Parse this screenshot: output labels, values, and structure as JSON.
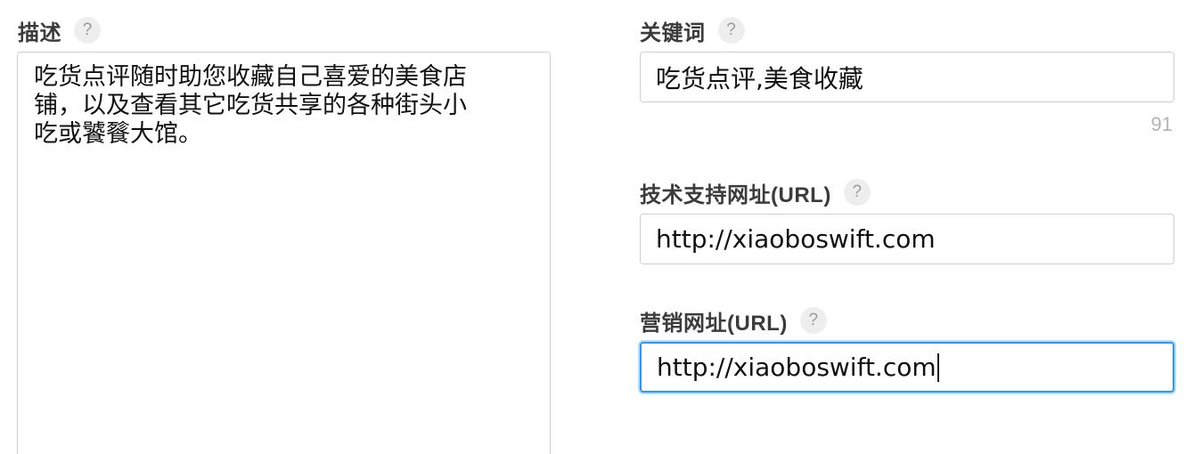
{
  "description": {
    "label": "描述",
    "help": "?",
    "value": "吃货点评随时助您收藏自己喜爱的美食店\n铺，以及查看其它吃货共享的各种街头小\n吃或饕餮大馆。"
  },
  "keywords": {
    "label": "关键词",
    "help": "?",
    "value": "吃货点评,美食收藏",
    "remaining": "91"
  },
  "support_url": {
    "label": "技术支持网址(URL)",
    "help": "?",
    "value": "http://xiaoboswift.com"
  },
  "marketing_url": {
    "label": "营销网址(URL)",
    "help": "?",
    "value": "http://xiaoboswift.com"
  },
  "colors": {
    "focus_border": "#2b9af3",
    "field_border": "#cfcfcf"
  }
}
